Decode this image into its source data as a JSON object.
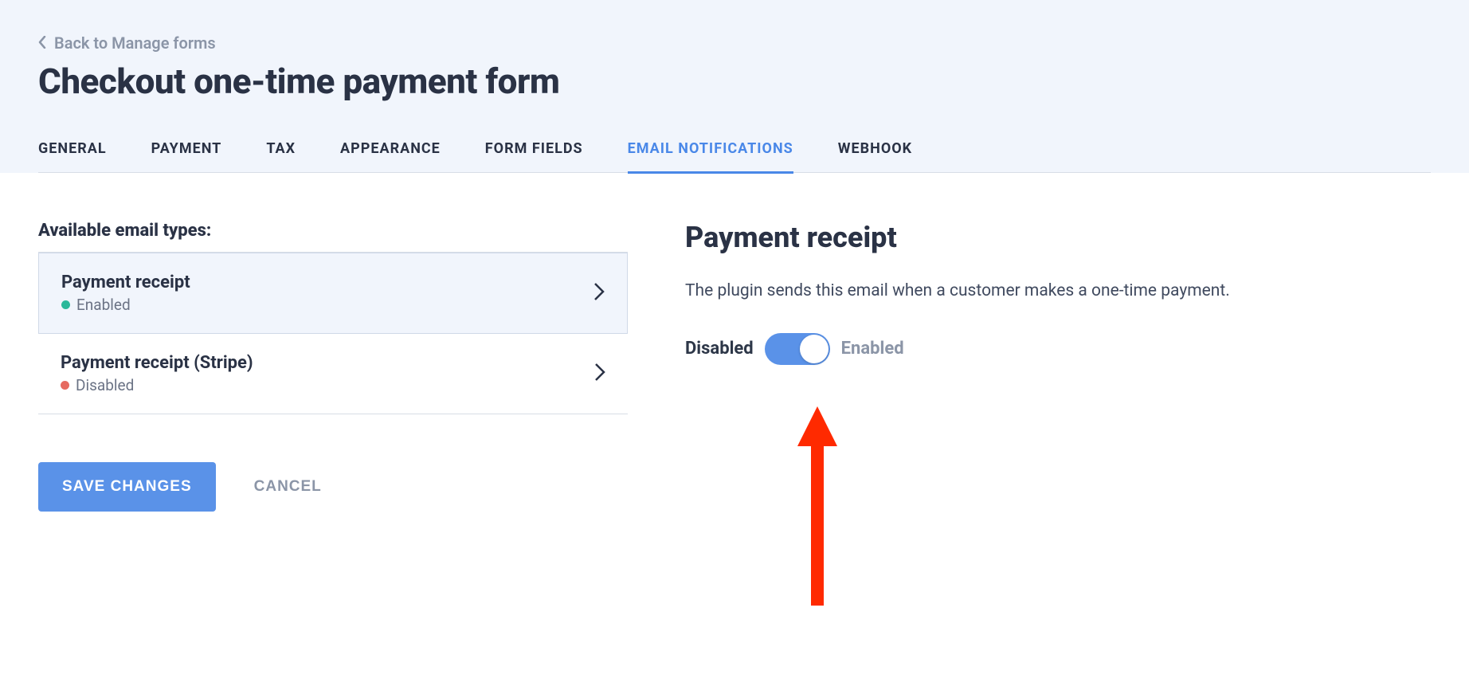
{
  "back_link": "Back to Manage forms",
  "page_title": "Checkout one-time payment form",
  "tabs": [
    {
      "label": "GENERAL"
    },
    {
      "label": "PAYMENT"
    },
    {
      "label": "TAX"
    },
    {
      "label": "APPEARANCE"
    },
    {
      "label": "FORM FIELDS"
    },
    {
      "label": "EMAIL NOTIFICATIONS"
    },
    {
      "label": "WEBHOOK"
    }
  ],
  "active_tab_index": 5,
  "email_types_label": "Available email types:",
  "email_types": [
    {
      "title": "Payment receipt",
      "status": "Enabled",
      "status_kind": "enabled"
    },
    {
      "title": "Payment receipt (Stripe)",
      "status": "Disabled",
      "status_kind": "disabled"
    }
  ],
  "detail": {
    "title": "Payment receipt",
    "desc": "The plugin sends this email when a customer makes a one-time payment.",
    "left_label": "Disabled",
    "right_label": "Enabled",
    "enabled": true
  },
  "actions": {
    "save": "SAVE CHANGES",
    "cancel": "CANCEL"
  },
  "annotation": {
    "arrow_color": "#ff2a00"
  }
}
